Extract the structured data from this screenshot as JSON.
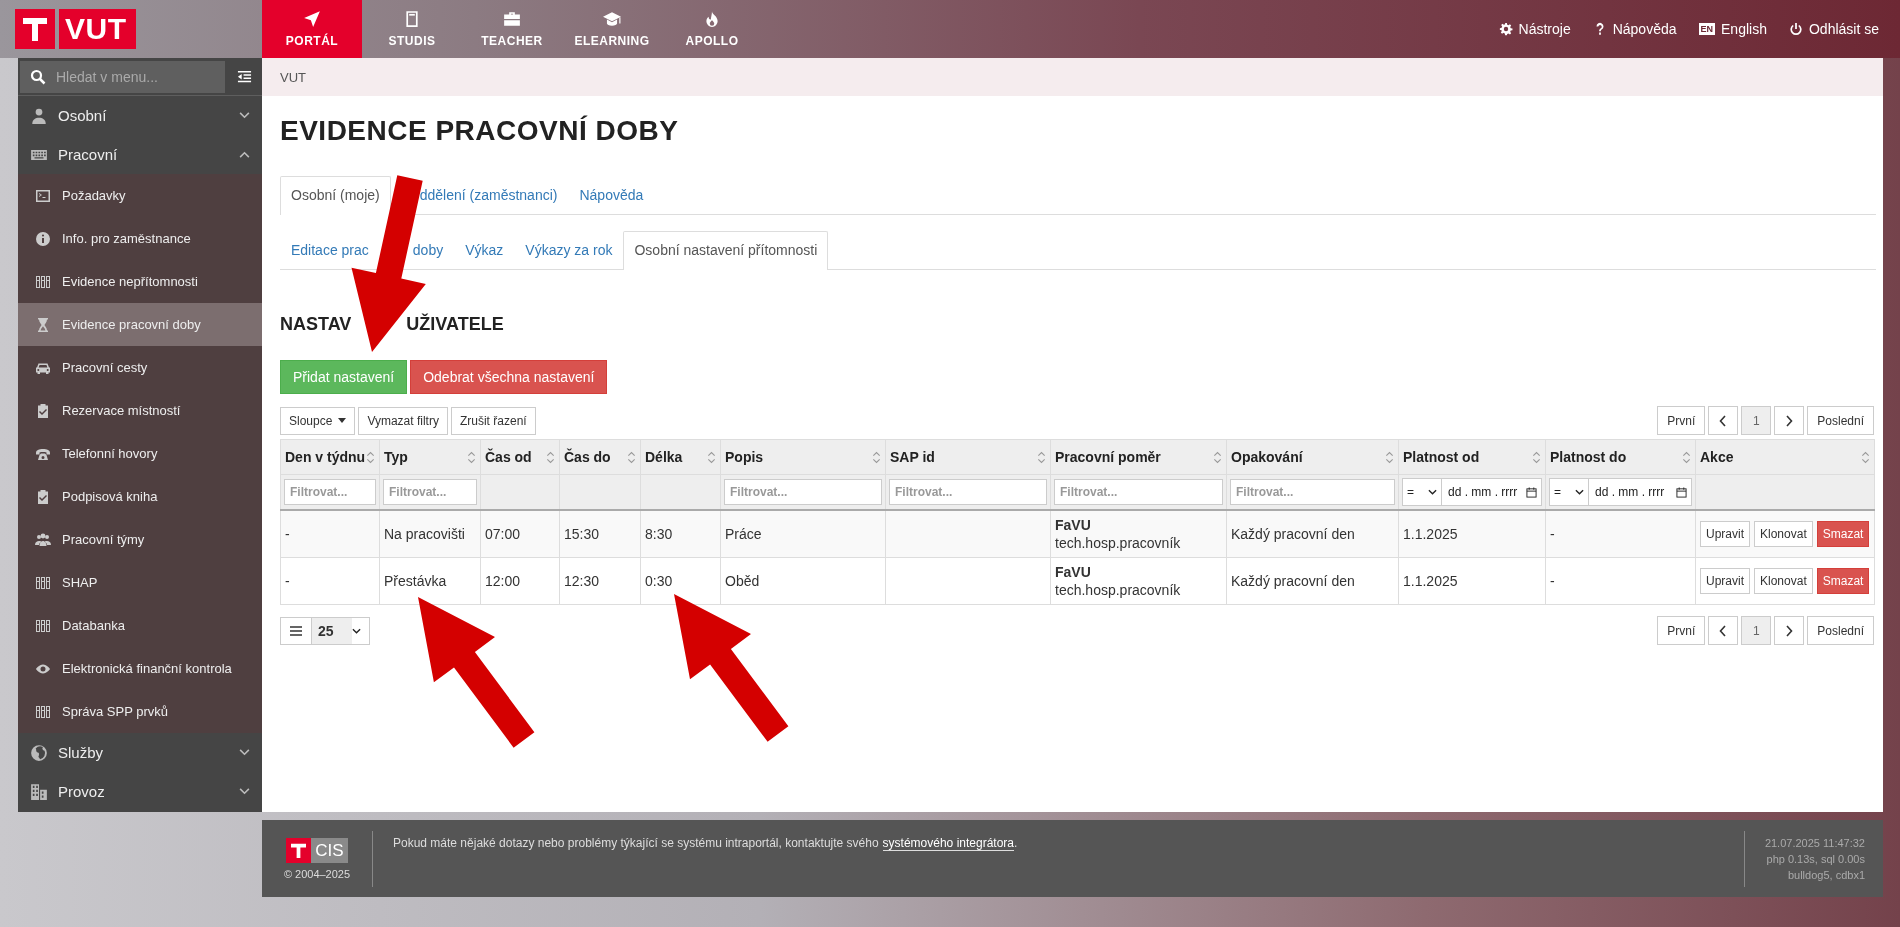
{
  "brand": {
    "name": "VUT"
  },
  "top_nav": [
    {
      "label": "PORTÁL",
      "selected": true
    },
    {
      "label": "STUDIS",
      "selected": false
    },
    {
      "label": "TEACHER",
      "selected": false
    },
    {
      "label": "ELEARNING",
      "selected": false
    },
    {
      "label": "APOLLO",
      "selected": false
    }
  ],
  "top_links": [
    {
      "label": "Nástroje"
    },
    {
      "label": "Nápověda"
    },
    {
      "label": "English",
      "badge": "EN"
    },
    {
      "label": "Odhlásit se"
    }
  ],
  "sidebar": {
    "search_placeholder": "Hledat v menu...",
    "items": [
      {
        "label": "Osobní",
        "expanded": false
      },
      {
        "label": "Pracovní",
        "expanded": true,
        "children": [
          {
            "label": "Požadavky",
            "selected": false
          },
          {
            "label": "Info. pro zaměstnance",
            "selected": false
          },
          {
            "label": "Evidence nepřítomnosti",
            "selected": false
          },
          {
            "label": "Evidence pracovní doby",
            "selected": true
          },
          {
            "label": "Pracovní cesty",
            "selected": false
          },
          {
            "label": "Rezervace místností",
            "selected": false
          },
          {
            "label": "Telefonní hovory",
            "selected": false
          },
          {
            "label": "Podpisová kniha",
            "selected": false
          },
          {
            "label": "Pracovní týmy",
            "selected": false
          },
          {
            "label": "SHAP",
            "selected": false
          },
          {
            "label": "Databanka",
            "selected": false
          },
          {
            "label": "Elektronická finanční kontrola",
            "selected": false
          },
          {
            "label": "Správa SPP prvků",
            "selected": false
          }
        ]
      },
      {
        "label": "Služby",
        "expanded": false
      },
      {
        "label": "Provoz",
        "expanded": false
      }
    ]
  },
  "breadcrumb": [
    "VUT"
  ],
  "title": "EVIDENCE PRACOVNÍ DOBY",
  "tabs": [
    {
      "label": "Osobní (moje)",
      "selected": true
    },
    {
      "label": "ddělení (zaměstnanci)",
      "selected": false
    },
    {
      "label": "Nápověda",
      "selected": false
    }
  ],
  "subtabs": [
    {
      "label_parts": [
        "Editace prac",
        "doby"
      ],
      "selected": false
    },
    {
      "label": "Výkaz",
      "selected": false
    },
    {
      "label": "Výkazy za rok",
      "selected": false
    },
    {
      "label": "Osobní nastavení přítomnosti",
      "selected": true
    }
  ],
  "section_title": [
    "NASTAV",
    "UŽIVATELE"
  ],
  "actions": [
    {
      "label": "Přidat nastavení",
      "kind": "success"
    },
    {
      "label": "Odebrat všechna nastavení",
      "kind": "danger"
    }
  ],
  "table_tools": [
    {
      "label": "Sloupce",
      "dropdown": true
    },
    {
      "label": "Vymazat filtry",
      "dropdown": false
    },
    {
      "label": "Zrušit řazení",
      "dropdown": false
    }
  ],
  "pagination_top": {
    "first": "První",
    "last": "Poslední",
    "pages": [
      {
        "label": "1",
        "selected": true
      }
    ]
  },
  "table": {
    "columns": [
      {
        "label": "Den v týdnu",
        "filter": {
          "kind": "text",
          "placeholder": "Filtrovat..."
        }
      },
      {
        "label": "Typ",
        "filter": {
          "kind": "text",
          "placeholder": "Filtrovat..."
        }
      },
      {
        "label": "Čas od",
        "filter": {
          "kind": "none"
        }
      },
      {
        "label": "Čas do",
        "filter": {
          "kind": "none"
        }
      },
      {
        "label": "Délka",
        "filter": {
          "kind": "none"
        }
      },
      {
        "label": "Popis",
        "filter": {
          "kind": "text",
          "placeholder": "Filtrovat..."
        }
      },
      {
        "label": "SAP id",
        "filter": {
          "kind": "text",
          "placeholder": "Filtrovat..."
        }
      },
      {
        "label": "Pracovní poměr",
        "filter": {
          "kind": "text",
          "placeholder": "Filtrovat..."
        }
      },
      {
        "label": "Opakování",
        "filter": {
          "kind": "text",
          "placeholder": "Filtrovat..."
        }
      },
      {
        "label": "Platnost od",
        "filter": {
          "kind": "date",
          "operator": "=",
          "placeholder": "dd . mm . rrrr"
        }
      },
      {
        "label": "Platnost do",
        "filter": {
          "kind": "date",
          "operator": "=",
          "placeholder": "dd . mm . rrrr"
        }
      },
      {
        "label": "Akce",
        "filter": {
          "kind": "none"
        }
      }
    ],
    "rows": [
      {
        "day": "-",
        "type": "Na pracovišti",
        "from": "07:00",
        "to": "15:30",
        "length": "8:30",
        "description": "Práce",
        "employment": {
          "unit": "FaVU",
          "position": "tech.hosp.pracovník"
        },
        "repeat": "Každý pracovní den",
        "valid_from": "1.1.2025",
        "valid_to": "-",
        "actions": [
          {
            "label": "Upravit",
            "kind": "default"
          },
          {
            "label": "Klonovat",
            "kind": "default"
          },
          {
            "label": "Smazat",
            "kind": "danger"
          }
        ]
      },
      {
        "day": "-",
        "type": "Přestávka",
        "from": "12:00",
        "to": "12:30",
        "length": "0:30",
        "description": "Oběd",
        "employment": {
          "unit": "FaVU",
          "position": "tech.hosp.pracovník"
        },
        "repeat": "Každý pracovní den",
        "valid_from": "1.1.2025",
        "valid_to": "-",
        "actions": [
          {
            "label": "Upravit",
            "kind": "default"
          },
          {
            "label": "Klonovat",
            "kind": "default"
          },
          {
            "label": "Smazat",
            "kind": "danger"
          }
        ]
      }
    ]
  },
  "page_size": "25",
  "pagination_bottom": {
    "first": "První",
    "last": "Poslední",
    "pages": [
      {
        "label": "1",
        "selected": true
      }
    ]
  },
  "footer": {
    "logo": "CIS",
    "copyright": "© 2004–2025",
    "message": "Pokud máte nějaké dotazy nebo problémy týkající se systému intraportál, kontaktujte svého",
    "link": "systémového integrátora",
    "message_end": ".",
    "info": [
      "21.07.2025 11:47:32",
      "php 0.13s, sql 0.00s",
      "bulldog5, cdbx1"
    ]
  }
}
